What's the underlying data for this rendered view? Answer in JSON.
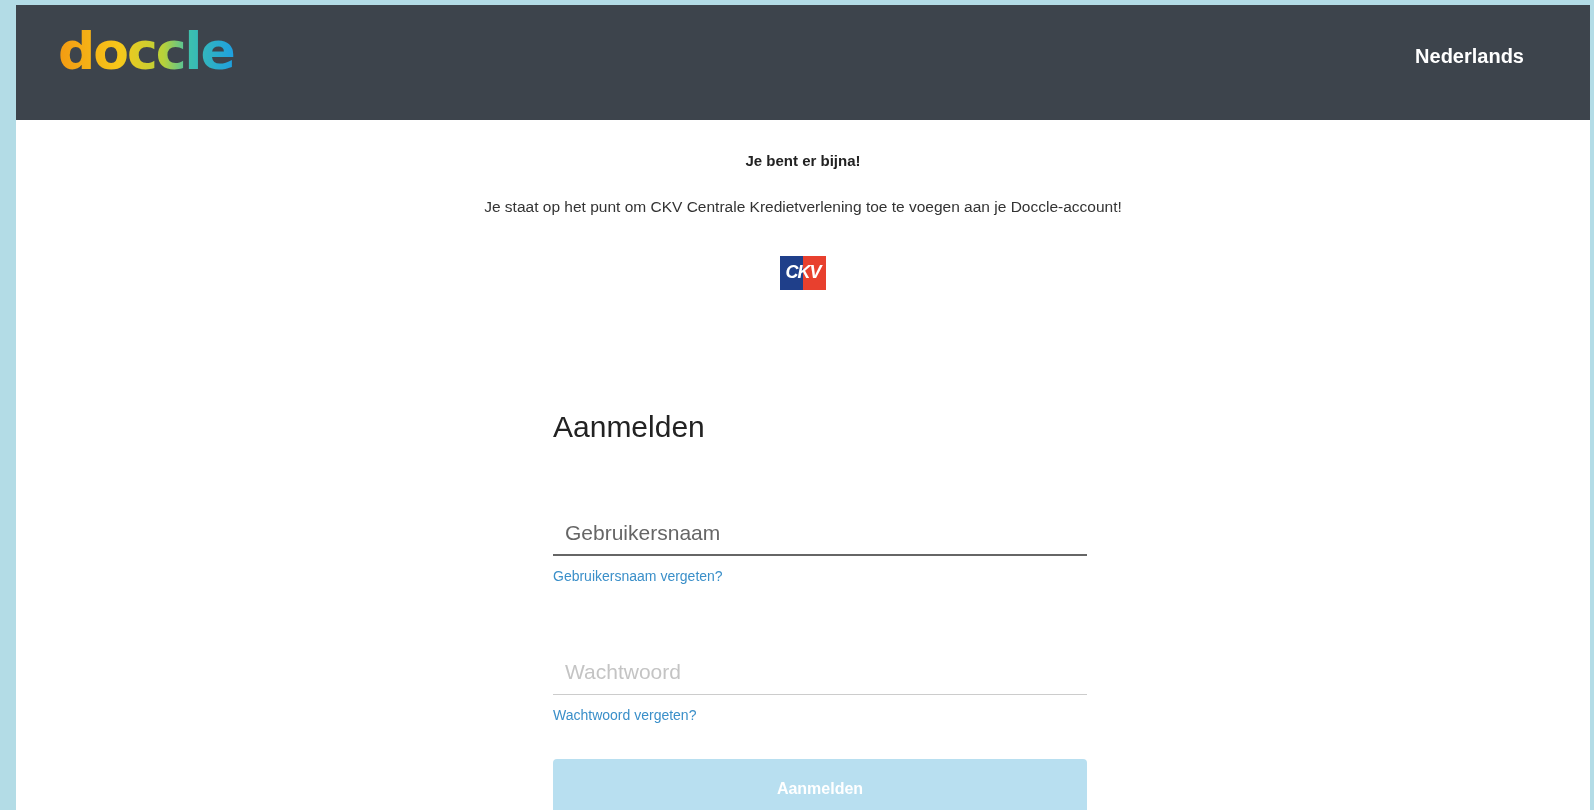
{
  "header": {
    "logo": "doccle",
    "language": "Nederlands"
  },
  "intro": {
    "title": "Je bent er bijna!",
    "message": "Je staat op het punt om CKV Centrale Kredietverlening toe te voegen aan je Doccle-account!",
    "partner_logo": "CKV"
  },
  "login": {
    "heading": "Aanmelden",
    "fields": [
      {
        "placeholder": "Gebruikersnaam",
        "focused": true,
        "help_link": "Gebruikersnaam vergeten?"
      },
      {
        "placeholder": "Wachtwoord",
        "focused": false,
        "help_link": "Wachtwoord vergeten?"
      }
    ],
    "submit": {
      "label": "Aanmelden",
      "disabled": true
    }
  }
}
